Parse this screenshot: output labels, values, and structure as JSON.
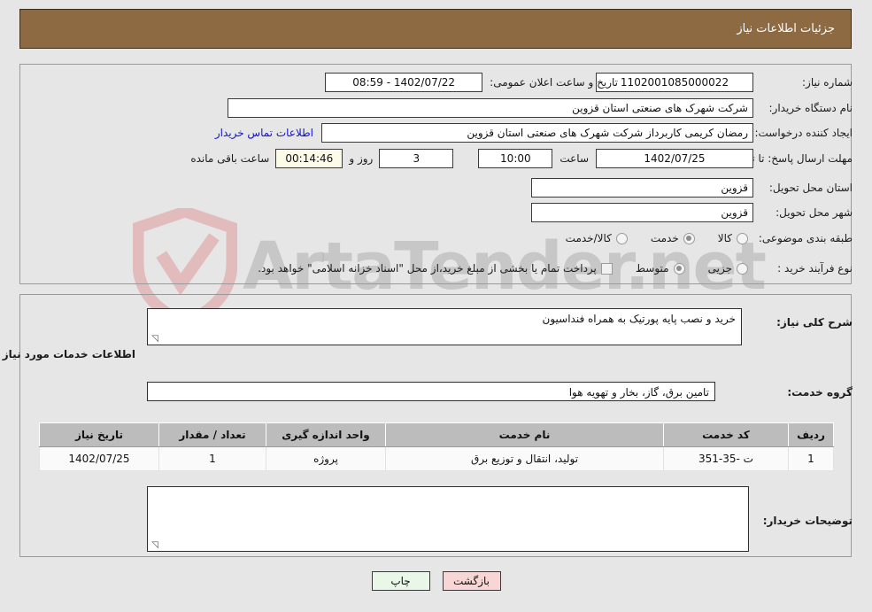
{
  "header": {
    "title": "جزئیات اطلاعات نیاز",
    "bg_color": "#8d6a42"
  },
  "watermark": {
    "text": "ArtaTender.net",
    "shield_color": "#e0b4b4",
    "text_color": "#787878"
  },
  "top_panel": {
    "need_number": {
      "label": "شماره نیاز:",
      "value": "1102001085000022"
    },
    "public_announce": {
      "label": "تاریخ و ساعت اعلان عمومی:",
      "value": "1402/07/22 - 08:59"
    },
    "buyer_org": {
      "label": "نام دستگاه خریدار:",
      "value": "شرکت شهرک های صنعتی استان قزوین"
    },
    "request_creator": {
      "label": "ایجاد کننده درخواست:",
      "value": "رمضان کریمی کاربرداز شرکت شهرک های صنعتی استان قزوین"
    },
    "contact_link": "اطلاعات تماس خریدار",
    "deadline": {
      "label": "مهلت ارسال پاسخ: تا تاریخ:",
      "date": "1402/07/25",
      "time_label": "ساعت",
      "time": "10:00",
      "days": "3",
      "days_label": "روز و",
      "countdown": "00:14:46",
      "countdown_label": "ساعت باقی مانده"
    },
    "delivery_province": {
      "label": "استان محل تحویل:",
      "value": "قزوین"
    },
    "delivery_city": {
      "label": "شهر محل تحویل:",
      "value": "قزوین"
    },
    "category": {
      "label": "طبقه بندی موضوعی:",
      "options": [
        {
          "label": "کالا",
          "selected": false
        },
        {
          "label": "خدمت",
          "selected": true
        },
        {
          "label": "کالا/خدمت",
          "selected": false
        }
      ]
    },
    "purchase_type": {
      "label": "نوع فرآیند خرید :",
      "options": [
        {
          "label": "جزیی",
          "selected": false
        },
        {
          "label": "متوسط",
          "selected": true
        }
      ],
      "checkbox_label": "پرداخت تمام یا بخشی از مبلغ خرید،از محل \"اسناد خزانه اسلامی\" خواهد بود.",
      "checkbox_checked": false
    }
  },
  "bottom_panel": {
    "general_desc": {
      "label": "شرح کلی نیاز:",
      "value": "خرید و نصب پایه پورتیک به همراه فنداسیون"
    },
    "services_heading": "اطلاعات خدمات مورد نیاز",
    "service_group": {
      "label": "گروه خدمت:",
      "value": "تامین برق، گاز، بخار و تهویه هوا"
    },
    "table": {
      "columns": [
        "ردیف",
        "کد خدمت",
        "نام خدمت",
        "واحد اندازه گیری",
        "تعداد / مقدار",
        "تاریخ نیاز"
      ],
      "rows": [
        {
          "row_no": "1",
          "service_code": "ت -35-351",
          "service_name": "تولید، انتقال و توزیع برق",
          "unit": "پروژه",
          "quantity": "1",
          "need_date": "1402/07/25"
        }
      ]
    },
    "buyer_notes": {
      "label": "توضیحات خریدار:",
      "value": ""
    }
  },
  "buttons": {
    "print": "چاپ",
    "back": "بازگشت"
  }
}
